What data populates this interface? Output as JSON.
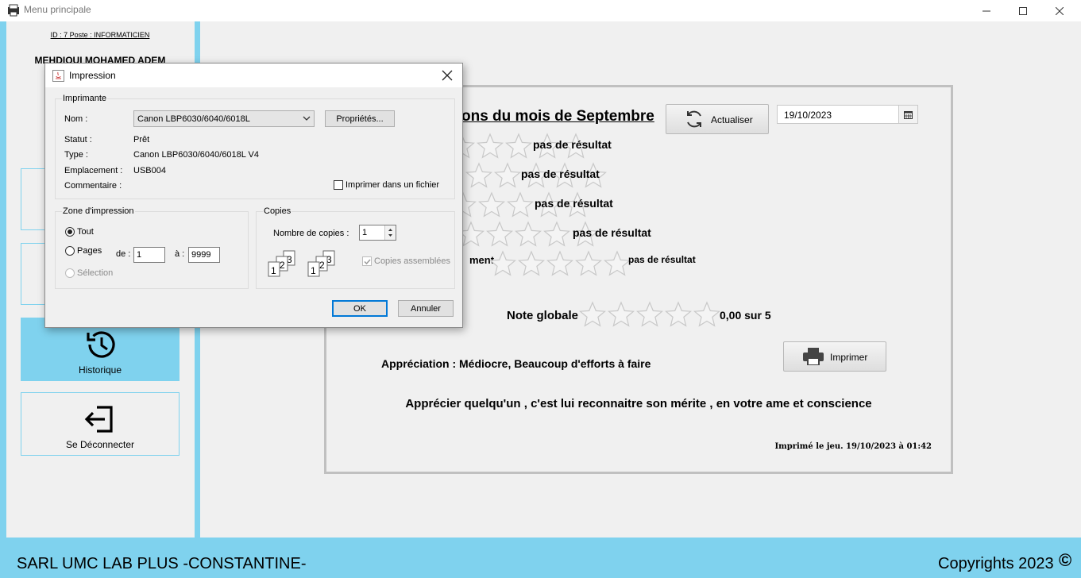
{
  "window": {
    "title": "Menu principale"
  },
  "sidebar": {
    "user_id": "ID : 7 Poste : INFORMATICIEN",
    "user_name": "MEHDIOUI MOHAMED ADEM",
    "items": [
      {
        "label": "Historique",
        "icon": "history-icon",
        "active": true
      },
      {
        "label": "Se Déconnecter",
        "icon": "logout-icon",
        "active": false
      }
    ]
  },
  "report": {
    "title": "ons du mois de Septembre",
    "refresh_label": "Actualiser",
    "date": "19/10/2023",
    "criteria": [
      {
        "label": "",
        "result": "pas de résultat",
        "rating": 0
      },
      {
        "label": "",
        "result": "pas de résultat",
        "rating": 0
      },
      {
        "label": "",
        "result": "pas de résultat",
        "rating": 0
      },
      {
        "label": "",
        "result": "pas de résultat",
        "rating": 0
      },
      {
        "label": "ment",
        "result": "pas de résultat",
        "rating": 0
      }
    ],
    "global_label": "Note globale",
    "global_value": "0,00 sur 5",
    "global_rating": 0,
    "print_label": "Imprimer",
    "appreciation": "Appréciation : Médiocre, Beaucoup d'efforts à faire",
    "quote": "Apprécier quelqu'un , c'est lui reconnaitre son mérite , en votre ame et conscience",
    "printed_at": "Imprimé le jeu. 19/10/2023  à 01:42"
  },
  "footer": {
    "company": "SARL UMC LAB PLUS -CONSTANTINE-",
    "copyright": "Copyrights 2023",
    "copy_symbol": "©"
  },
  "print_dialog": {
    "title": "Impression",
    "printer_group": "Imprimante",
    "name_label": "Nom :",
    "printer_name": "Canon LBP6030/6040/6018L",
    "properties_label": "Propriétés...",
    "status_label": "Statut :",
    "status_value": "Prêt",
    "type_label": "Type :",
    "type_value": "Canon LBP6030/6040/6018L V4",
    "location_label": "Emplacement :",
    "location_value": "USB004",
    "comment_label": "Commentaire :",
    "print_to_file_label": "Imprimer dans un fichier",
    "zone_group": "Zone d'impression",
    "all_label": "Tout",
    "pages_label": "Pages",
    "from_label": "de :",
    "from_value": "1",
    "to_label": "à :",
    "to_value": "9999",
    "selection_label": "Sélection",
    "copies_group": "Copies",
    "copies_count_label": "Nombre de copies :",
    "copies_count": "1",
    "collate_label": "Copies assemblées",
    "ok_label": "OK",
    "cancel_label": "Annuler"
  },
  "colors": {
    "accent": "#7fd2ee",
    "panel_bg": "#f0f0f0",
    "dialog_focus": "#0078d7"
  }
}
